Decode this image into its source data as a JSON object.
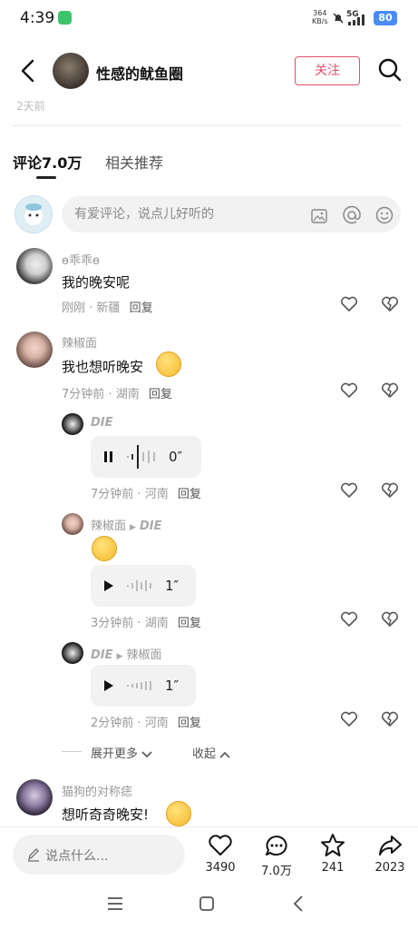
{
  "status_bar": {
    "time": "4:39",
    "speed_value": "364",
    "speed_unit": "KB/s",
    "network": "5G",
    "battery": "80"
  },
  "header": {
    "title": "性感的鱿鱼圈",
    "follow_label": "关注",
    "prev_timestamp": "2天前"
  },
  "tabs": [
    {
      "label": "评论7.0万",
      "active": true
    },
    {
      "label": "相关推荐",
      "active": false
    }
  ],
  "comment_input": {
    "placeholder": "有爱评论，说点儿好听的"
  },
  "comments": [
    {
      "user": "ɵ乖乖ɵ",
      "text": "我的晚安呢",
      "time": "刚刚",
      "location": "新疆",
      "reply_label": "回复"
    },
    {
      "user": "辣椒面",
      "text": "我也想听晚安",
      "time": "7分钟前",
      "location": "湖南",
      "reply_label": "回复",
      "replies": [
        {
          "user": "DIE",
          "voice_duration": "0″",
          "time": "7分钟前",
          "location": "河南",
          "reply_label": "回复"
        },
        {
          "user": "辣椒面",
          "to": "DIE",
          "voice_duration": "1″",
          "time": "3分钟前",
          "location": "湖南",
          "reply_label": "回复"
        },
        {
          "user": "DIE",
          "to": "辣椒面",
          "voice_duration": "1″",
          "time": "2分钟前",
          "location": "河南",
          "reply_label": "回复"
        }
      ]
    },
    {
      "user": "猫狗的对称痣",
      "text": "想听奇奇晚安!"
    }
  ],
  "thread_controls": {
    "expand_label": "展开更多",
    "collapse_label": "收起"
  },
  "bottom_bar": {
    "input_placeholder": "说点什么...",
    "likes": "3490",
    "comments": "7.0万",
    "favorites": "241",
    "shares": "2023"
  },
  "colors": {
    "accent": "#e0506e",
    "voice_bg": "#f2f2f2"
  },
  "icons": [
    "back-icon",
    "search-icon",
    "image-icon",
    "at-icon",
    "emoji-icon",
    "heart-icon",
    "broken-heart-icon",
    "play-icon",
    "pause-icon",
    "comment-icon",
    "star-icon",
    "share-icon",
    "pencil-icon",
    "menu-icon",
    "home-icon"
  ]
}
